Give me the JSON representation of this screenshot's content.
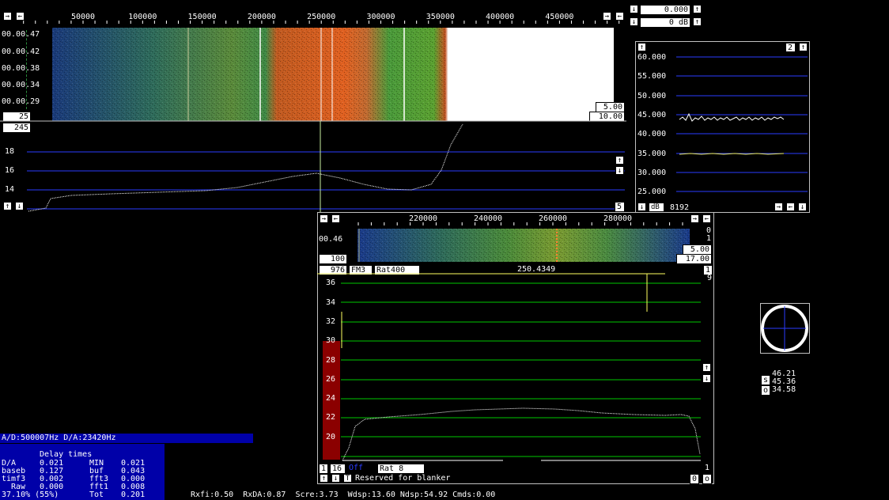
{
  "main_waterfall": {
    "freq_ticks": [
      "50000",
      "100000",
      "150000",
      "200000",
      "250000",
      "300000",
      "350000",
      "400000",
      "450000"
    ],
    "time_labels": [
      "00.00.47",
      "00.00.42",
      "00.00.38",
      "00.00.34",
      "00.00.29"
    ],
    "avg_box": "25",
    "gain_box": "5.00",
    "zero_box": "10.00",
    "level_box": "245"
  },
  "top_controls": {
    "gain_value": "0.000",
    "db_value": "0 dB"
  },
  "main_spectrum": {
    "y_labels": [
      "18",
      "16",
      "14"
    ],
    "corner_box": "5"
  },
  "power_graph": {
    "corner_box": "2",
    "y_labels": [
      "60.000",
      "55.000",
      "50.000",
      "45.000",
      "40.000",
      "35.000",
      "30.000",
      "25.000"
    ],
    "db_button": "dB",
    "size_label": "8192"
  },
  "hires_waterfall": {
    "freq_ticks": [
      "220000",
      "240000",
      "260000",
      "280000"
    ],
    "time_label": "00.46",
    "avg_box": "100",
    "gain_box": "5.00",
    "zero_box": "17.00",
    "right_zero": "0",
    "right_one": "1"
  },
  "hires_spectrum": {
    "bw_box": "976",
    "mode_box": "FM3",
    "rat_box": "Rat400",
    "freq_readout": "250.4349",
    "top_right_1": "1",
    "top_right_9": "9",
    "y_labels": [
      "36",
      "34",
      "32",
      "30",
      "28",
      "26",
      "24",
      "22",
      "20"
    ],
    "bottom_one": "1",
    "bottom_box_16": "16",
    "bottom_btn_t": "T",
    "off_label": "Off",
    "rat_bottom": "Rat  8",
    "blanker_text": "Reserved for blanker",
    "bottom_right_0": "0",
    "bottom_right_o": "o"
  },
  "s_meter": {
    "s_btn": "s",
    "o_btn": "o",
    "val1": "46.21",
    "val2": "45.36",
    "val3": "34.58"
  },
  "status": {
    "ad_da": "A/D:500007Hz  D/A:23420Hz",
    "delay_title": "Delay times",
    "rows": [
      {
        "c1": "D/A",
        "c2": "0.021",
        "c3": "MIN",
        "c4": "0.021"
      },
      {
        "c1": "baseb",
        "c2": "0.127",
        "c3": "buf",
        "c4": "0.043"
      },
      {
        "c1": "timf3",
        "c2": "0.002",
        "c3": "fft3",
        "c4": "0.000"
      },
      {
        "c1": "Raw",
        "c2": "0.000",
        "c3": "fft1",
        "c4": "0.008"
      }
    ],
    "cpu": "37.10% (55%)",
    "tot_label": "Tot",
    "tot_value": "0.201",
    "bottom_line": "Rxfi:0.50  RxDA:0.87  Scre:3.73  Wdsp:13.60 Ndsp:54.92 Cmds:0.00"
  },
  "colors": {
    "grid_blue": "#2a3cff",
    "grid_green": "#00c800",
    "status_bg": "#0000a8",
    "bar_red": "#8b0000"
  }
}
